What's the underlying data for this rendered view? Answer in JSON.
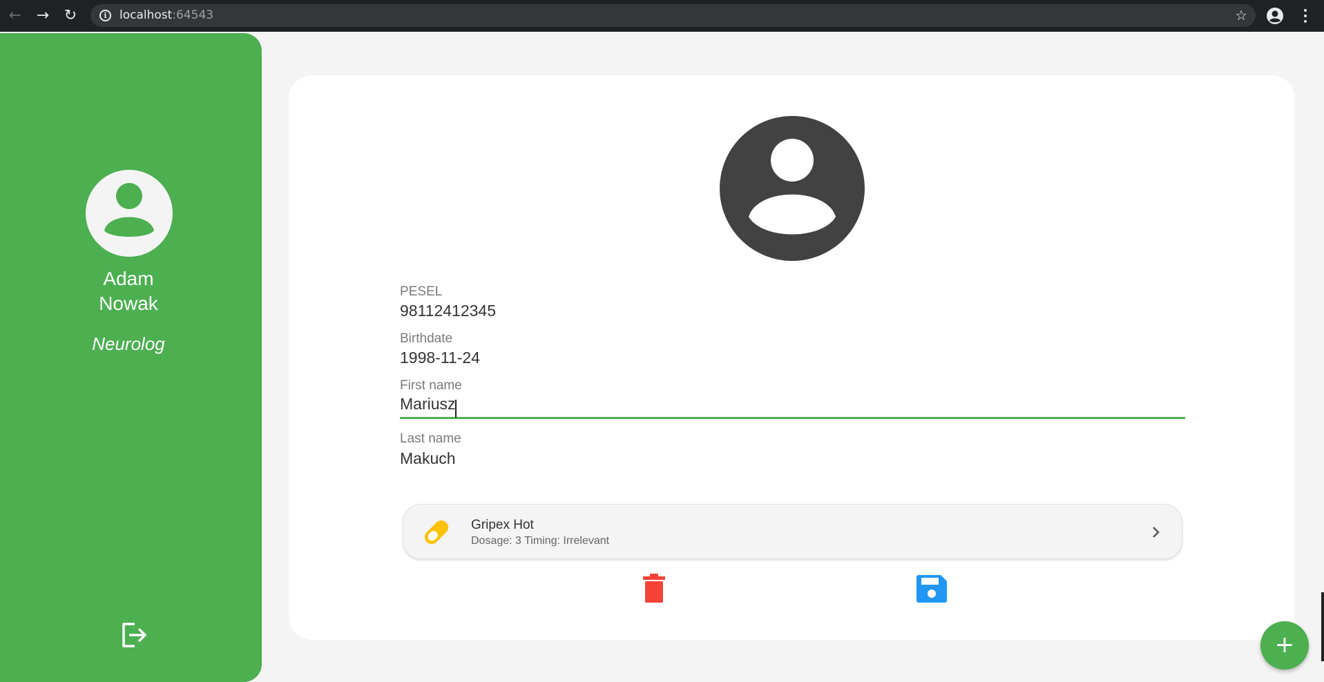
{
  "browser": {
    "url_host": "localhost",
    "url_port": ":64543"
  },
  "sidebar": {
    "user_first_name": "Adam",
    "user_last_name": "Nowak",
    "role": "Neurolog"
  },
  "patient": {
    "pesel_label": "PESEL",
    "pesel_value": "98112412345",
    "birthdate_label": "Birthdate",
    "birthdate_value": "1998-11-24",
    "first_name_label": "First name",
    "first_name_value": "Mariusz",
    "last_name_label": "Last name",
    "last_name_value": "Makuch"
  },
  "medications": [
    {
      "name": "Gripex Hot",
      "detail": "Dosage: 3 Timing: Irrelevant"
    }
  ],
  "fab": {
    "label": "+"
  },
  "colors": {
    "primary_green": "#4caf50",
    "delete_red": "#f44336",
    "save_blue": "#2196f3",
    "pill_yellow": "#ffc107",
    "avatar_dark": "#424242"
  }
}
